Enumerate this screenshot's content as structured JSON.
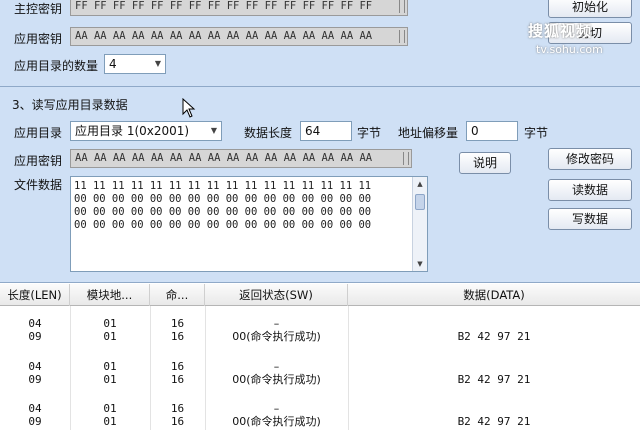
{
  "section2": {
    "master_key_label": "主控密钥",
    "master_key_value": "FF FF FF FF FF FF FF FF FF FF FF FF FF FF FF FF",
    "app_key_label": "应用密钥",
    "app_key_value": "AA AA AA AA AA AA AA AA AA AA AA AA AA AA AA AA",
    "dir_count_label": "应用目录的数量",
    "dir_count_value": "4",
    "init_button": "初始化",
    "cut_button": "剪切"
  },
  "watermark": {
    "main": "搜狐视频",
    "sub": "tv.sohu.com"
  },
  "section3": {
    "title": "3、读写应用目录数据",
    "app_dir_label": "应用目录",
    "app_dir_value": "应用目录 1(0x2001)",
    "data_len_label": "数据长度",
    "data_len_value": "64",
    "data_len_unit": "字节",
    "addr_offset_label": "地址偏移量",
    "addr_offset_value": "0",
    "addr_offset_unit": "字节",
    "app_key_label": "应用密钥",
    "app_key_value": "AA AA AA AA AA AA AA AA AA AA AA AA AA AA AA AA",
    "file_data_label": "文件数据",
    "file_data_value": "11 11 11 11 11 11 11 11 11 11 11 11 11 11 11 11\n00 00 00 00 00 00 00 00 00 00 00 00 00 00 00 00\n00 00 00 00 00 00 00 00 00 00 00 00 00 00 00 00\n00 00 00 00 00 00 00 00 00 00 00 00 00 00 00 00",
    "explain_button": "说明",
    "change_key_button": "修改密码",
    "read_button": "读数据",
    "write_button": "写数据"
  },
  "log_table": {
    "columns": [
      "长度(LEN)",
      "模块地...",
      "命...",
      "返回状态(SW)",
      "数据(DATA)"
    ],
    "rows": [
      {
        "len": "04",
        "addr": "01",
        "cmd": "16",
        "sw": "–",
        "data": ""
      },
      {
        "len": "09",
        "addr": "01",
        "cmd": "16",
        "sw": "00(命令执行成功)",
        "data": "B2 42 97 21"
      },
      {
        "len": "04",
        "addr": "01",
        "cmd": "16",
        "sw": "–",
        "data": ""
      },
      {
        "len": "09",
        "addr": "01",
        "cmd": "16",
        "sw": "00(命令执行成功)",
        "data": "B2 42 97 21"
      },
      {
        "len": "04",
        "addr": "01",
        "cmd": "16",
        "sw": "–",
        "data": ""
      },
      {
        "len": "09",
        "addr": "01",
        "cmd": "16",
        "sw": "00(命令执行成功)",
        "data": "B2 42 97 21"
      }
    ]
  }
}
